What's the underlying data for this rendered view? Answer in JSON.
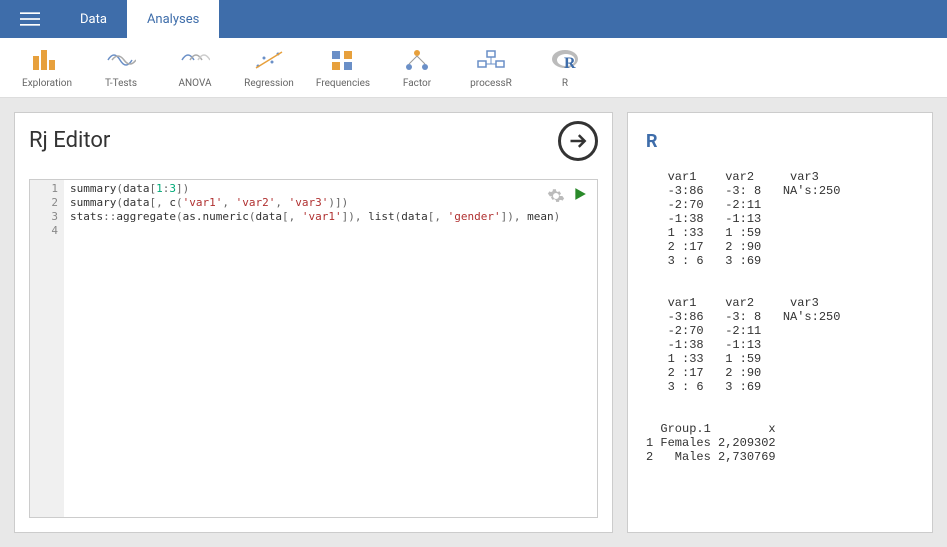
{
  "topbar": {
    "tabs": [
      {
        "label": "Data",
        "active": false
      },
      {
        "label": "Analyses",
        "active": true
      }
    ]
  },
  "ribbon": [
    {
      "name": "exploration",
      "label": "Exploration"
    },
    {
      "name": "ttests",
      "label": "T-Tests"
    },
    {
      "name": "anova",
      "label": "ANOVA"
    },
    {
      "name": "regression",
      "label": "Regression"
    },
    {
      "name": "frequencies",
      "label": "Frequencies"
    },
    {
      "name": "factor",
      "label": "Factor"
    },
    {
      "name": "processr",
      "label": "processR"
    },
    {
      "name": "r",
      "label": "R"
    }
  ],
  "editor": {
    "title": "Rj Editor",
    "line_numbers": [
      "1",
      "2",
      "3",
      "4"
    ],
    "code_lines": [
      {
        "tokens": [
          {
            "t": "summary",
            "c": "fn"
          },
          {
            "t": "(",
            "c": "pn"
          },
          {
            "t": "data",
            "c": "fn"
          },
          {
            "t": "[",
            "c": "pn"
          },
          {
            "t": "1",
            "c": "nm"
          },
          {
            "t": ":",
            "c": "pn"
          },
          {
            "t": "3",
            "c": "nm"
          },
          {
            "t": "]",
            "c": "pn"
          },
          {
            "t": ")",
            "c": "pn"
          }
        ]
      },
      {
        "tokens": [
          {
            "t": "summary",
            "c": "fn"
          },
          {
            "t": "(",
            "c": "pn"
          },
          {
            "t": "data",
            "c": "fn"
          },
          {
            "t": "[, ",
            "c": "pn"
          },
          {
            "t": "c",
            "c": "fn"
          },
          {
            "t": "(",
            "c": "pn"
          },
          {
            "t": "'var1'",
            "c": "st"
          },
          {
            "t": ", ",
            "c": "pn"
          },
          {
            "t": "'var2'",
            "c": "st"
          },
          {
            "t": ", ",
            "c": "pn"
          },
          {
            "t": "'var3'",
            "c": "st"
          },
          {
            "t": ")",
            "c": "pn"
          },
          {
            "t": "]",
            "c": "pn"
          },
          {
            "t": ")",
            "c": "pn"
          }
        ]
      },
      {
        "tokens": [
          {
            "t": "stats",
            "c": "fn"
          },
          {
            "t": "::",
            "c": "pn"
          },
          {
            "t": "aggregate",
            "c": "fn"
          },
          {
            "t": "(",
            "c": "pn"
          },
          {
            "t": "as.numeric",
            "c": "fn"
          },
          {
            "t": "(",
            "c": "pn"
          },
          {
            "t": "data",
            "c": "fn"
          },
          {
            "t": "[, ",
            "c": "pn"
          },
          {
            "t": "'var1'",
            "c": "st"
          },
          {
            "t": "]",
            "c": "pn"
          },
          {
            "t": ")",
            "c": "pn"
          },
          {
            "t": ", ",
            "c": "pn"
          },
          {
            "t": "list",
            "c": "fn"
          },
          {
            "t": "(",
            "c": "pn"
          },
          {
            "t": "data",
            "c": "fn"
          },
          {
            "t": "[, ",
            "c": "pn"
          },
          {
            "t": "'gender'",
            "c": "st"
          },
          {
            "t": "]",
            "c": "pn"
          },
          {
            "t": ")",
            "c": "pn"
          },
          {
            "t": ", ",
            "c": "pn"
          },
          {
            "t": "mean",
            "c": "fn"
          },
          {
            "t": ")",
            "c": "pn"
          }
        ]
      },
      {
        "tokens": []
      }
    ]
  },
  "output": {
    "title": "R",
    "text": "   var1    var2     var3\n   -3:86   -3: 8   NA's:250\n   -2:70   -2:11\n   -1:38   -1:13\n   1 :33   1 :59\n   2 :17   2 :90\n   3 : 6   3 :69\n\n\n   var1    var2     var3\n   -3:86   -3: 8   NA's:250\n   -2:70   -2:11\n   -1:38   -1:13\n   1 :33   1 :59\n   2 :17   2 :90\n   3 : 6   3 :69\n\n\n  Group.1        x\n1 Females 2,209302\n2   Males 2,730769"
  }
}
